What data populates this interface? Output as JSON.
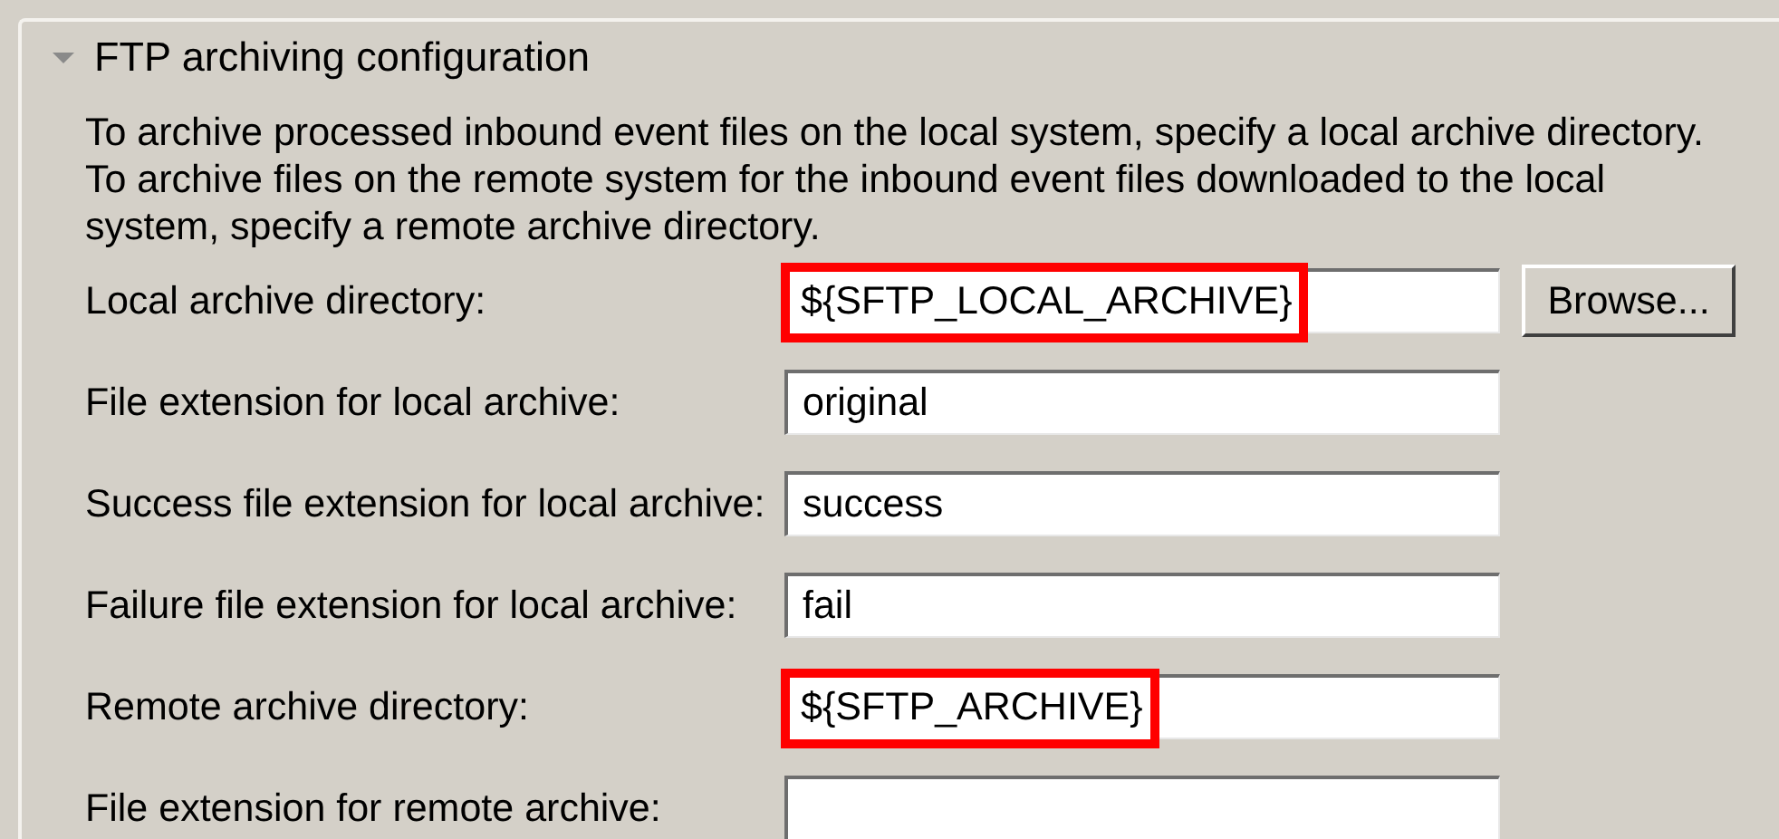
{
  "section": {
    "title": "FTP archiving configuration",
    "expanded": true,
    "description": "To archive processed inbound event files on the local system, specify a local archive directory. To archive files on the remote system for the inbound event files downloaded to the local system, specify a remote archive directory.",
    "fields": [
      {
        "label": "Local archive directory:",
        "value": "${SFTP_LOCAL_ARCHIVE}",
        "highlighted": true,
        "button": "Browse..."
      },
      {
        "label": "File extension for local archive:",
        "value": "original",
        "highlighted": false
      },
      {
        "label": "Success file extension for local archive:",
        "value": "success",
        "highlighted": false
      },
      {
        "label": "Failure file extension for local archive:",
        "value": "fail",
        "highlighted": false
      },
      {
        "label": "Remote archive directory:",
        "value": "${SFTP_ARCHIVE}",
        "highlighted": true
      },
      {
        "label": "File extension for remote archive:",
        "highlighted": false
      }
    ]
  }
}
